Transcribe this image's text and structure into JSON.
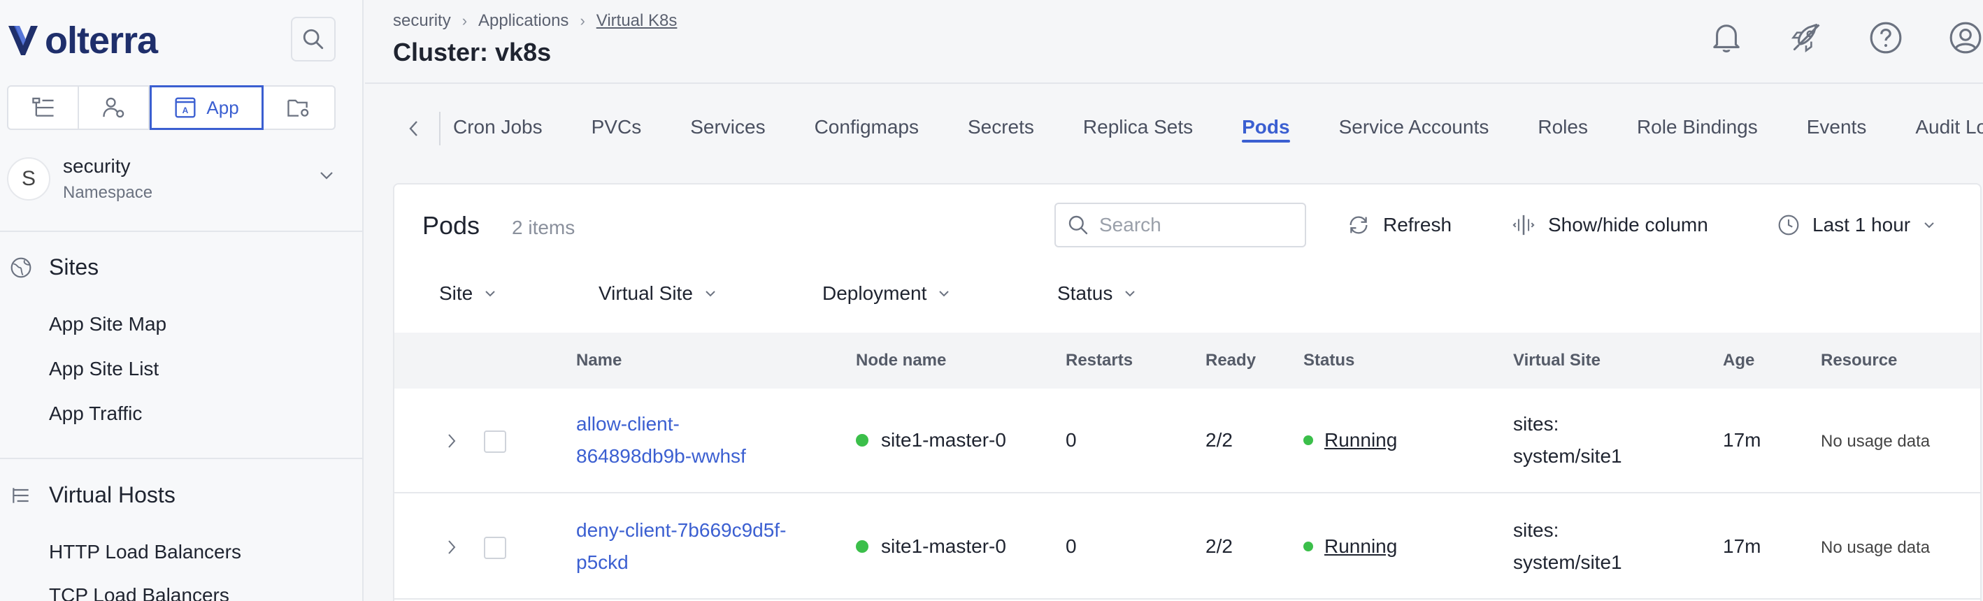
{
  "sidebar": {
    "logo_text": "olterra",
    "mode_tabs": [
      {
        "icon": "hierarchy-icon"
      },
      {
        "icon": "user-settings-icon"
      },
      {
        "icon": "app-icon",
        "label": "App"
      },
      {
        "icon": "folder-settings-icon"
      }
    ],
    "namespace": {
      "avatar": "S",
      "name": "security",
      "sub": "Namespace"
    },
    "sections": [
      {
        "title": "Sites",
        "icon": "globe-icon",
        "items": [
          "App Site Map",
          "App Site List",
          "App Traffic"
        ]
      },
      {
        "title": "Virtual Hosts",
        "icon": "virtual-hosts-icon",
        "items": [
          "HTTP Load Balancers",
          "TCP Load Balancers"
        ]
      }
    ]
  },
  "header": {
    "breadcrumbs": [
      "security",
      "Applications",
      "Virtual K8s"
    ],
    "title": "Cluster: vk8s",
    "icons": [
      "bell-icon",
      "rocket-icon",
      "help-icon",
      "user-icon"
    ]
  },
  "tabs": [
    "Cron Jobs",
    "PVCs",
    "Services",
    "Configmaps",
    "Secrets",
    "Replica Sets",
    "Pods",
    "Service Accounts",
    "Roles",
    "Role Bindings",
    "Events",
    "Audit Logs"
  ],
  "active_tab": "Pods",
  "panel": {
    "title": "Pods",
    "count": "2 items",
    "search_placeholder": "Search",
    "refresh_label": "Refresh",
    "columns_label": "Show/hide column",
    "time_label": "Last 1 hour",
    "filters": [
      "Site",
      "Virtual Site",
      "Deployment",
      "Status"
    ],
    "columns": [
      "Name",
      "Node name",
      "Restarts",
      "Ready",
      "Status",
      "Virtual Site",
      "Age",
      "Resource"
    ],
    "rows": [
      {
        "name_l1": "allow-client-",
        "name_l2": "864898db9b-wwhsf",
        "node": "site1-master-0",
        "restarts": "0",
        "ready": "2/2",
        "status": "Running",
        "vsite_l1": "sites:",
        "vsite_l2": "system/site1",
        "age": "17m",
        "resource": "No usage data"
      },
      {
        "name_l1": "deny-client-7b669c9d5f-",
        "name_l2": "p5ckd",
        "node": "site1-master-0",
        "restarts": "0",
        "ready": "2/2",
        "status": "Running",
        "vsite_l1": "sites:",
        "vsite_l2": "system/site1",
        "age": "17m",
        "resource": "No usage data"
      }
    ]
  },
  "colors": {
    "accent": "#3b5fd1",
    "running": "#3bbf4a",
    "logo": "#1f2f6b"
  }
}
